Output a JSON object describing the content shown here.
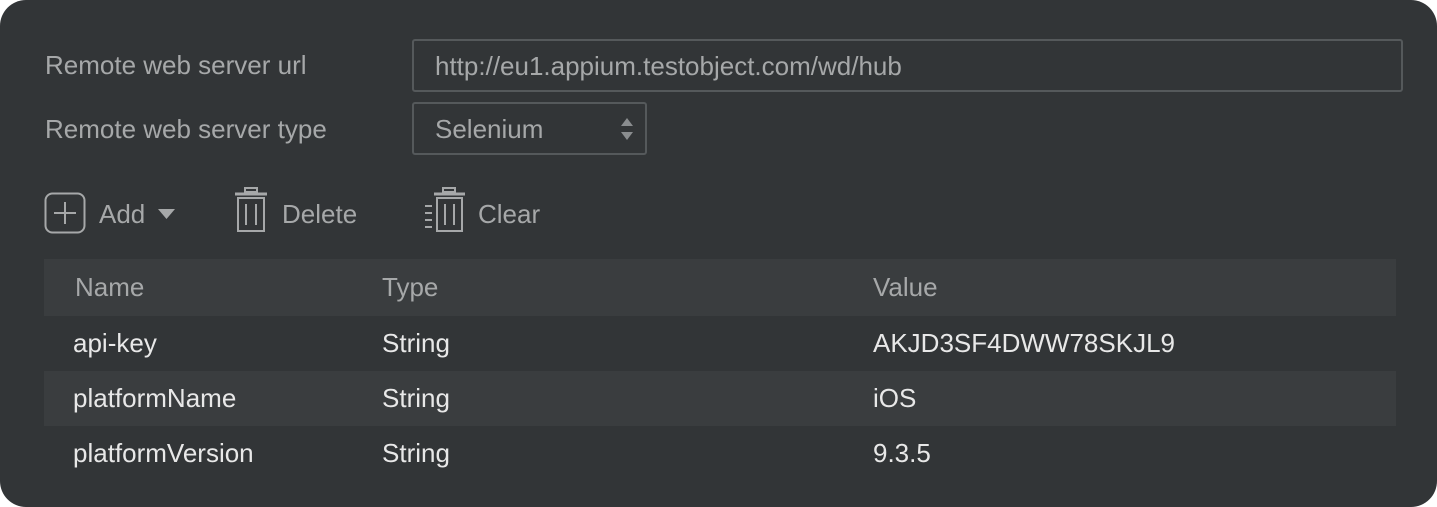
{
  "server": {
    "url_label": "Remote web server url",
    "url_value": "http://eu1.appium.testobject.com/wd/hub",
    "type_label": "Remote web server type",
    "type_value": "Selenium"
  },
  "toolbar": {
    "add_label": "Add",
    "delete_label": "Delete",
    "clear_label": "Clear"
  },
  "table": {
    "columns": [
      "Name",
      "Type",
      "Value"
    ],
    "rows": [
      {
        "name": "api-key",
        "type": "String",
        "value": "AKJD3SF4DWW78SKJL9"
      },
      {
        "name": "platformName",
        "type": "String",
        "value": "iOS"
      },
      {
        "name": "platformVersion",
        "type": "String",
        "value": "9.3.5"
      }
    ]
  },
  "icons": {
    "add": "plus-square-icon",
    "add_menu": "caret-down-icon",
    "delete": "trash-icon",
    "clear": "clear-list-icon",
    "select": "up-down-arrows-icon"
  },
  "colors": {
    "background": "#323537",
    "row_alt": "#3a3d3f",
    "muted_text": "#a6a8a9",
    "text": "#e8e8e8",
    "border": "#55595b"
  }
}
